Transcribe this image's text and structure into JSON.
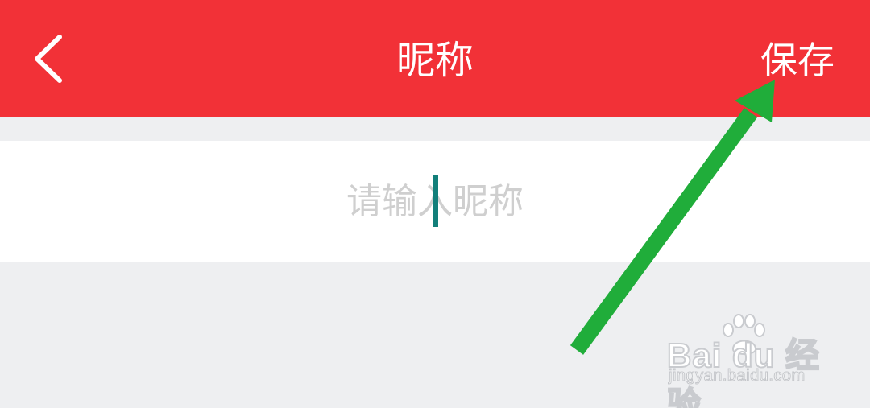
{
  "header": {
    "back_icon": "chevron-left-icon",
    "title": "昵称",
    "save_label": "保存"
  },
  "nickname_input": {
    "value": "",
    "placeholder": "请输入昵称"
  },
  "annotation": {
    "arrow_icon": "green-arrow-icon",
    "arrow_color": "#20ad3a"
  },
  "watermark": {
    "brand": "Bai  du 经验",
    "url": "jingyan.baidu.com"
  },
  "colors": {
    "header_background": "#f23137",
    "page_background": "#eeeff1",
    "input_background": "#ffffff",
    "caret": "#127f7a",
    "placeholder": "#cfcfcf"
  }
}
